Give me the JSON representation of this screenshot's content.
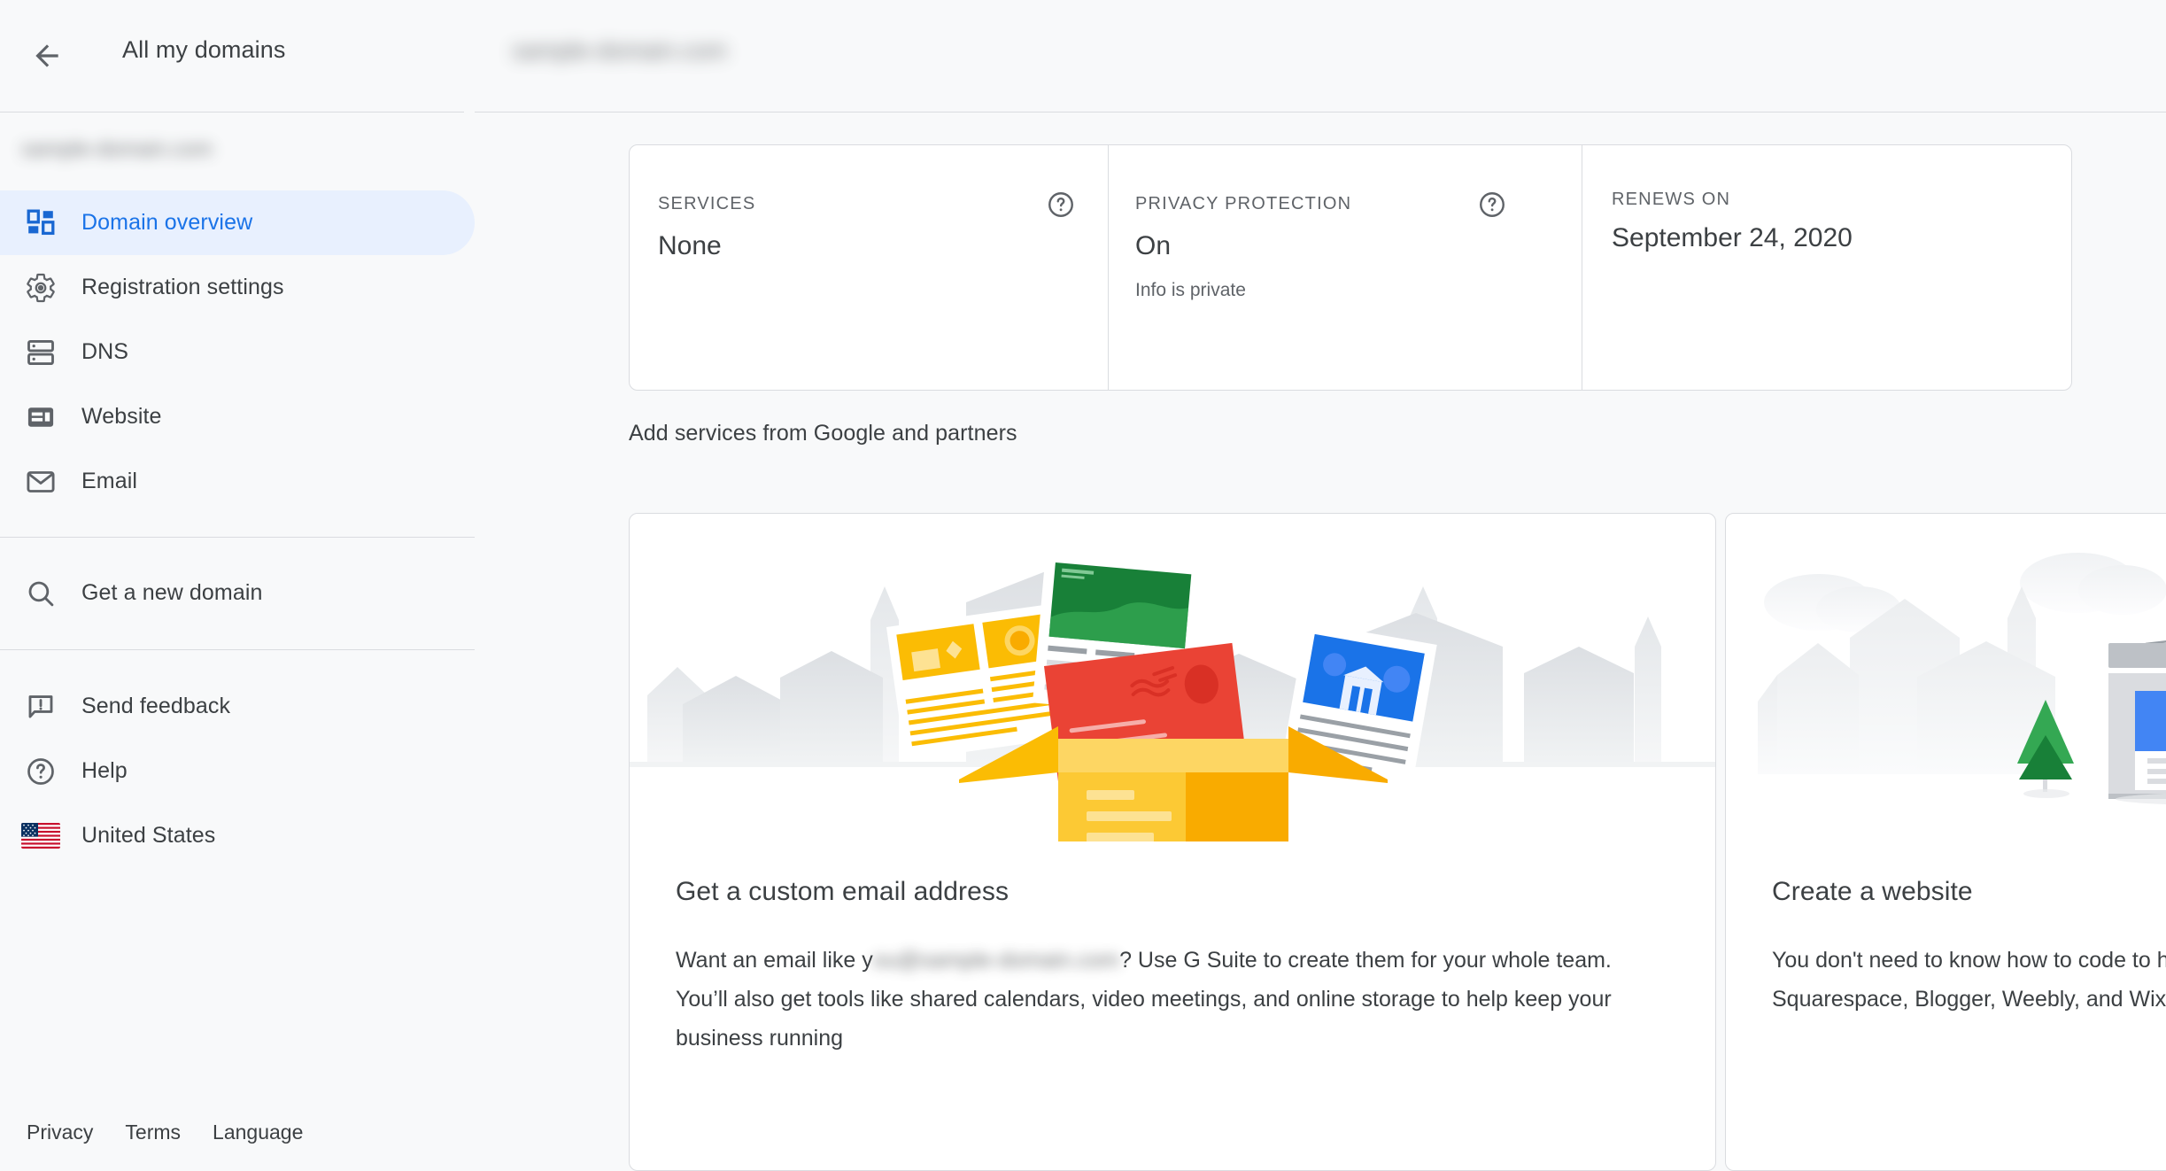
{
  "header": {
    "back_label": "back-arrow",
    "all_domains_label": "All my domains",
    "domain_name_redacted": "sample-domain.com"
  },
  "sidebar": {
    "domain_name_redacted": "sample-domain.com",
    "items": [
      {
        "label": "Domain overview",
        "icon": "dashboard-icon",
        "active": true
      },
      {
        "label": "Registration settings",
        "icon": "gear-icon",
        "active": false
      },
      {
        "label": "DNS",
        "icon": "dns-server-icon",
        "active": false
      },
      {
        "label": "Website",
        "icon": "website-icon",
        "active": false
      },
      {
        "label": "Email",
        "icon": "envelope-icon",
        "active": false
      },
      {
        "label": "Get a new domain",
        "icon": "search-icon",
        "active": false
      },
      {
        "label": "Send feedback",
        "icon": "feedback-icon",
        "active": false
      },
      {
        "label": "Help",
        "icon": "help-circle-icon",
        "active": false
      },
      {
        "label": "United States",
        "icon": "us-flag-icon",
        "active": false
      }
    ],
    "footer_links": [
      {
        "label": "Privacy"
      },
      {
        "label": "Terms"
      },
      {
        "label": "Language"
      }
    ]
  },
  "main": {
    "info_card": {
      "services": {
        "label": "SERVICES",
        "value": "None",
        "sub": "",
        "help_icon": "help-circle-icon"
      },
      "privacy": {
        "label": "PRIVACY PROTECTION",
        "value": "On",
        "sub": "Info is private",
        "help_icon": "help-circle-icon"
      },
      "renews_on": {
        "label": "RENEWS ON",
        "value": "September 24, 2020",
        "sub": ""
      }
    },
    "section_title": "Add services from Google and partners",
    "service_cards": [
      {
        "illustration": "open-box-with-mail-illustration",
        "title": "Get a custom email address",
        "body_before": "Want an email like y",
        "body_redacted": "ou@sample-domain.com",
        "body_after": "? Use G Suite to create them for your whole team. You’ll also get tools like shared calendars, video meetings, and online storage to help keep your business running"
      },
      {
        "illustration": "crane-lifting-website-illustration",
        "title": "Create a website",
        "body_before": "You don't need to know how to code to have a great site for your business. Services like Shopify, Squarespace, Blogger, Weebly, and Wix make it easy to create a website or blog.",
        "body_redacted": "",
        "body_after": ""
      }
    ]
  },
  "colors": {
    "page_background": "#f8f9fa",
    "card_background": "#ffffff",
    "border": "#dadce0",
    "accent_blue": "#1a73e8",
    "active_pill": "#e8f0fe",
    "text_primary": "#3c4043",
    "text_secondary": "#5f6368",
    "google_yellow": "#fbbc04",
    "google_red": "#ea4335",
    "google_green": "#34a853",
    "google_blue": "#4285f4"
  }
}
